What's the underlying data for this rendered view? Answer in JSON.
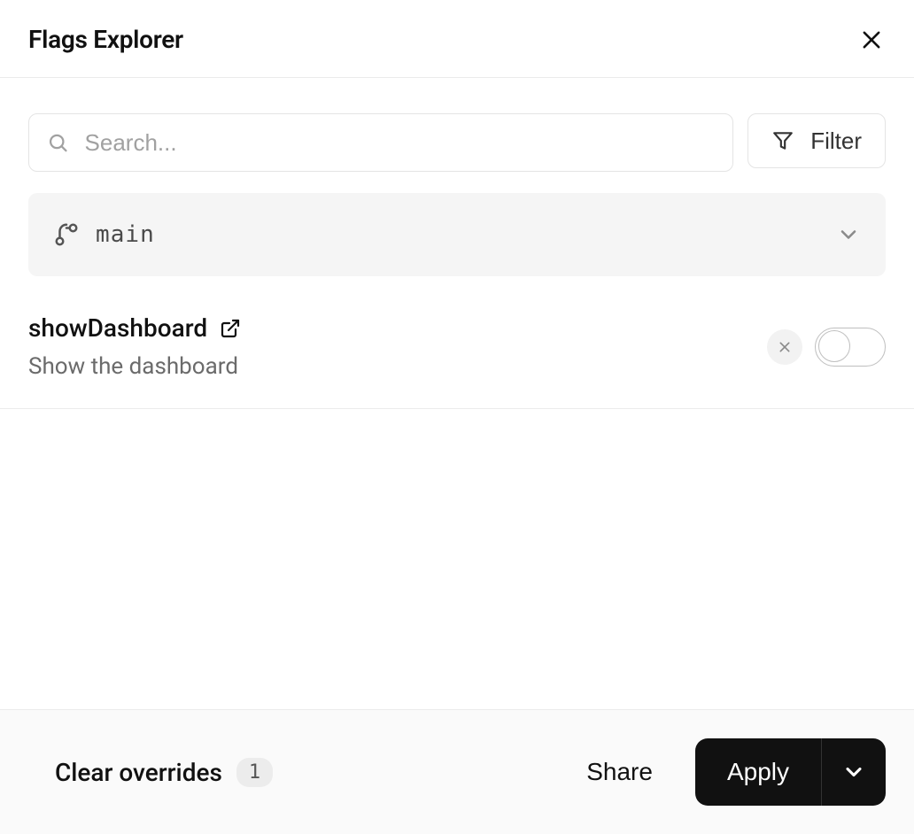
{
  "header": {
    "title": "Flags Explorer"
  },
  "search": {
    "placeholder": "Search...",
    "value": ""
  },
  "filter": {
    "label": "Filter"
  },
  "branch": {
    "name": "main"
  },
  "flags": [
    {
      "name": "showDashboard",
      "description": "Show the dashboard",
      "enabled": false
    }
  ],
  "footer": {
    "clear_label": "Clear overrides",
    "override_count": "1",
    "share_label": "Share",
    "apply_label": "Apply"
  }
}
